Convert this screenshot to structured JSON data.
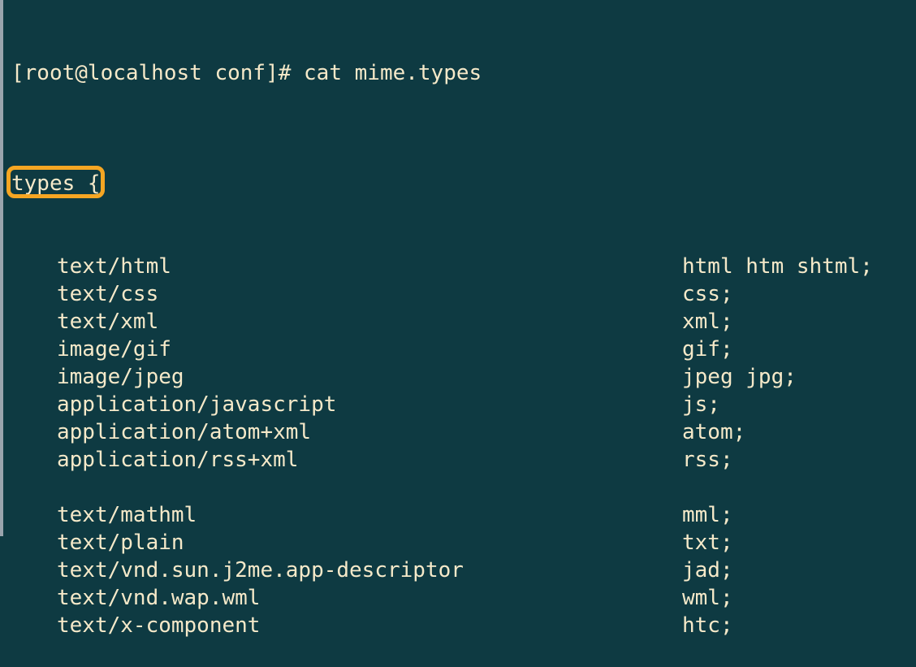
{
  "prompt": "[root@localhost conf]# cat mime.types",
  "types_open": "types {",
  "groups": [
    [
      {
        "mime": "text/html",
        "ext": "html htm shtml;"
      },
      {
        "mime": "text/css",
        "ext": "css;"
      },
      {
        "mime": "text/xml",
        "ext": "xml;"
      },
      {
        "mime": "image/gif",
        "ext": "gif;"
      },
      {
        "mime": "image/jpeg",
        "ext": "jpeg jpg;"
      },
      {
        "mime": "application/javascript",
        "ext": "js;"
      },
      {
        "mime": "application/atom+xml",
        "ext": "atom;"
      },
      {
        "mime": "application/rss+xml",
        "ext": "rss;"
      }
    ],
    [
      {
        "mime": "text/mathml",
        "ext": "mml;"
      },
      {
        "mime": "text/plain",
        "ext": "txt;"
      },
      {
        "mime": "text/vnd.sun.j2me.app-descriptor",
        "ext": "jad;"
      },
      {
        "mime": "text/vnd.wap.wml",
        "ext": "wml;"
      },
      {
        "mime": "text/x-component",
        "ext": "htc;"
      }
    ]
  ]
}
